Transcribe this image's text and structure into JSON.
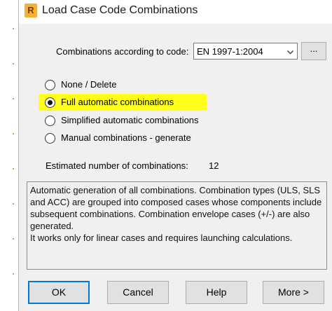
{
  "window": {
    "title": "Load Case Code Combinations",
    "app_icon": "R"
  },
  "code_selector": {
    "label": "Combinations according to code:",
    "value": "EN 1997-1:2004",
    "more_label": "..."
  },
  "radios": [
    {
      "label": "None / Delete",
      "selected": false
    },
    {
      "label": "Full automatic combinations",
      "selected": true,
      "highlighted": true
    },
    {
      "label": "Simplified automatic combinations",
      "selected": false
    },
    {
      "label": "Manual combinations - generate",
      "selected": false
    }
  ],
  "estimate": {
    "label": "Estimated number of combinations:",
    "value": "12"
  },
  "description": {
    "paragraph1": "Automatic generation of all combinations. Combination types (ULS, SLS and ACC) are grouped into composed cases whose components include subsequent combinations. Combination envelope cases (+/-) are also generated.",
    "paragraph2": "It works only for linear cases and requires launching calculations."
  },
  "buttons": {
    "ok": "OK",
    "cancel": "Cancel",
    "help": "Help",
    "more": "More >"
  },
  "colors": {
    "highlight": "#ffff1a",
    "focus": "#0078d7",
    "app_icon": "#f2b134"
  }
}
